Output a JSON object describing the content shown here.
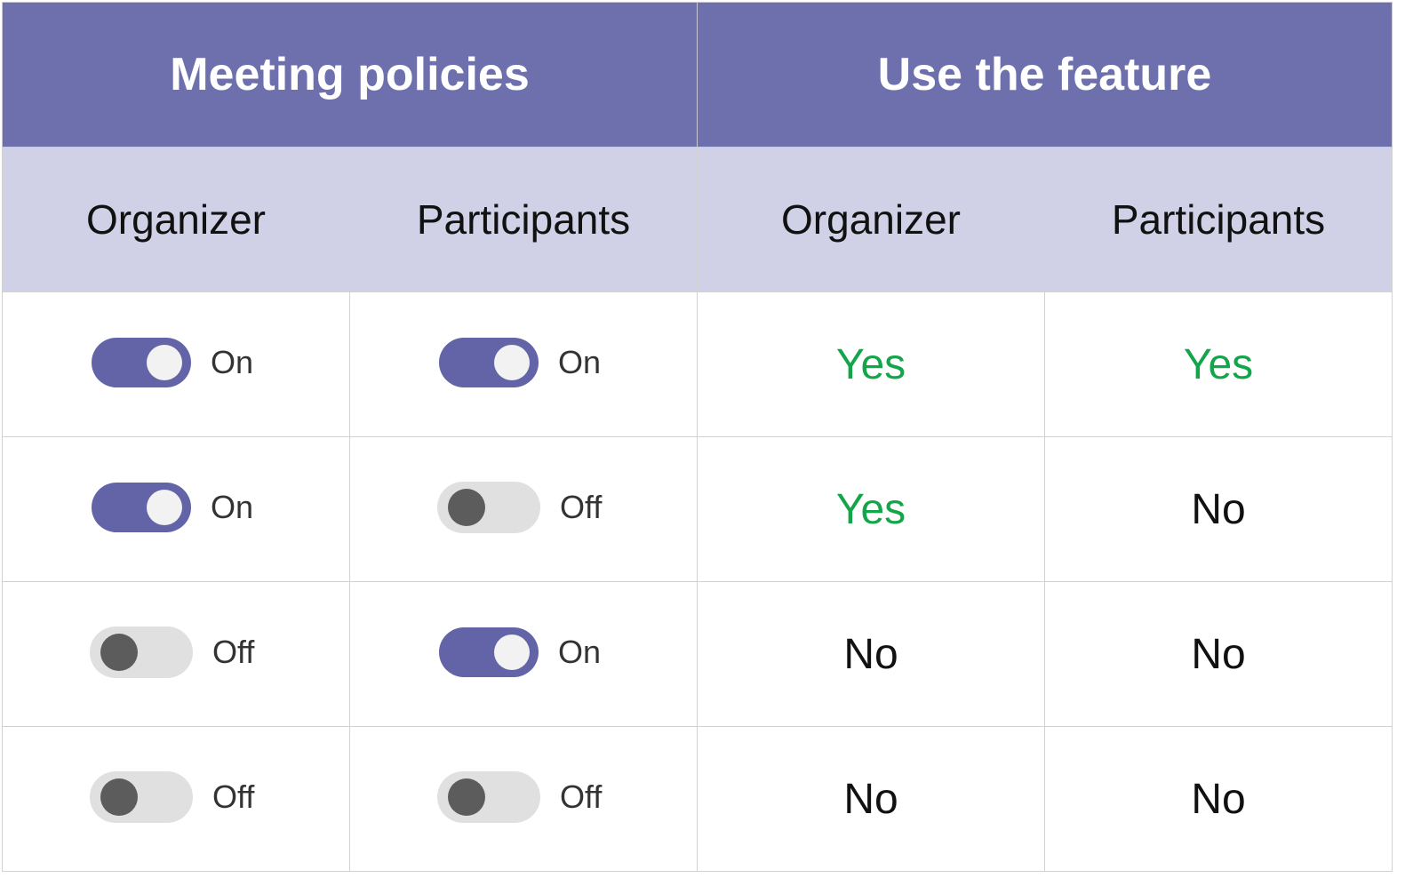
{
  "header": {
    "groups": [
      "Meeting policies",
      "Use the feature"
    ],
    "columns": [
      "Organizer",
      "Participants",
      "Organizer",
      "Participants"
    ]
  },
  "colors": {
    "header": "#6e70ae",
    "subheader": "#d0d1e6",
    "toggle_on": "#6264a7",
    "toggle_off": "#e0e0e0",
    "yes": "#13a54a"
  },
  "rows": [
    {
      "policy_organizer": "On",
      "policy_participants": "On",
      "use_organizer": "Yes",
      "use_participants": "Yes"
    },
    {
      "policy_organizer": "On",
      "policy_participants": "Off",
      "use_organizer": "Yes",
      "use_participants": "No"
    },
    {
      "policy_organizer": "Off",
      "policy_participants": "On",
      "use_organizer": "No",
      "use_participants": "No"
    },
    {
      "policy_organizer": "Off",
      "policy_participants": "Off",
      "use_organizer": "No",
      "use_participants": "No"
    }
  ]
}
